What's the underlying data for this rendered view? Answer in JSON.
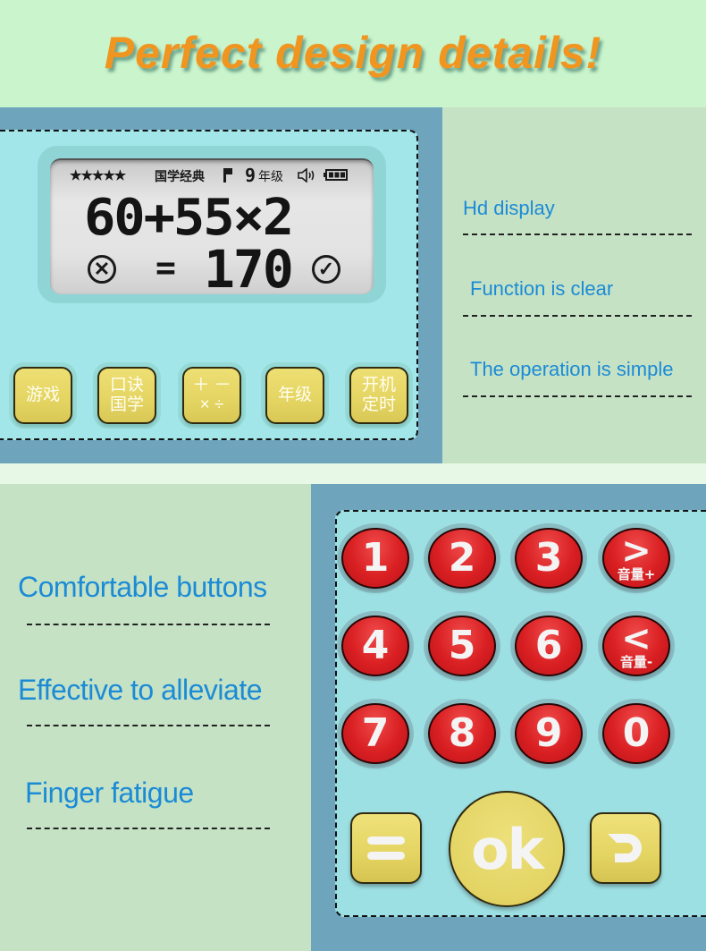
{
  "header": {
    "title": "Perfect design details!"
  },
  "display": {
    "rating_stars": "★★★★★",
    "mode_label": "国学经典",
    "flag_icon": "flag-icon",
    "grade_number": "9",
    "grade_label": "年级",
    "speaker_icon": "speaker-icon",
    "battery_icon": "battery-icon",
    "expression": "60+55×2",
    "equals": "=",
    "result": "170",
    "wrong_symbol": "✕",
    "right_symbol": "✓"
  },
  "function_buttons": [
    {
      "label": "游戏"
    },
    {
      "label": "口诀\n国学",
      "line1": "口诀",
      "line2": "国学"
    },
    {
      "label": "＋ －\n× ÷",
      "line1": "＋ －",
      "line2": "× ÷"
    },
    {
      "label": "年级"
    },
    {
      "label": "开机\n定时",
      "line1": "开机",
      "line2": "定时"
    }
  ],
  "features_top": [
    {
      "text": "Hd display"
    },
    {
      "text": "Function is clear"
    },
    {
      "text": "The operation is simple"
    }
  ],
  "features_bottom": [
    {
      "text": "Comfortable buttons"
    },
    {
      "text": "Effective to alleviate"
    },
    {
      "text": "Finger fatigue"
    }
  ],
  "keypad": {
    "keys": [
      {
        "label": "1"
      },
      {
        "label": "2"
      },
      {
        "label": "3"
      },
      {
        "label": ">",
        "sub": "音量+"
      },
      {
        "label": "4"
      },
      {
        "label": "5"
      },
      {
        "label": "6"
      },
      {
        "label": "<",
        "sub": "音量-"
      },
      {
        "label": "7"
      },
      {
        "label": "8"
      },
      {
        "label": "9"
      },
      {
        "label": "0"
      }
    ],
    "equals_label": "=",
    "ok_label": "ok",
    "back_icon": "return-icon"
  },
  "colors": {
    "title": "#f0951f",
    "feature_text": "#1b8bd6",
    "panel_blue": "#6ea5bd",
    "device_cyan": "#a2e6ea",
    "key_red": "#d91f22",
    "key_yellow": "#e4d462",
    "bg_green": "#c6e2c5"
  }
}
